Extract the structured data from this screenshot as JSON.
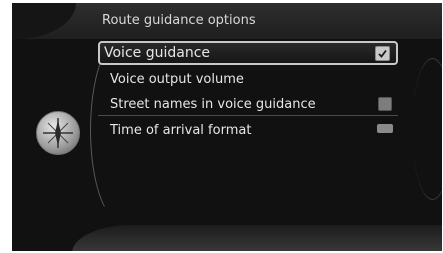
{
  "header": {
    "title": "Route guidance options"
  },
  "menu": {
    "items": [
      {
        "label": "Voice guidance",
        "control": "checkbox",
        "checked": true
      },
      {
        "label": "Voice output volume"
      },
      {
        "label": "Street names in voice guidance",
        "control": "checkbox",
        "checked": false
      },
      {
        "label": "Time of arrival format",
        "control": "format-badge"
      }
    ]
  },
  "icons": {
    "left_knob": "compass-icon"
  },
  "colors": {
    "background": "#111111",
    "text": "#e6e6e6",
    "highlight_border": "#c8c8c8"
  }
}
